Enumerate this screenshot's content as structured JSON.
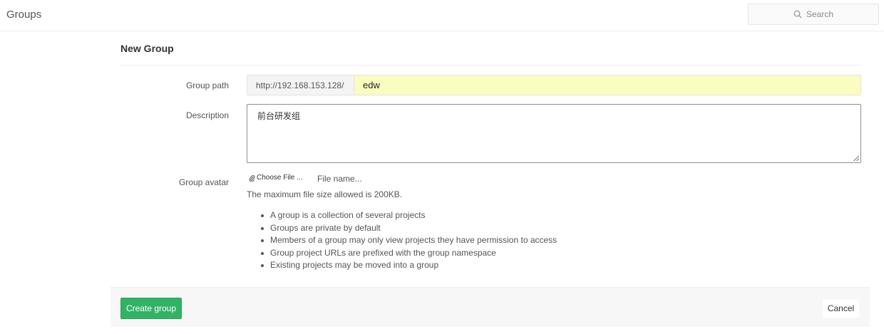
{
  "header": {
    "title": "Groups",
    "search_placeholder": "Search"
  },
  "form": {
    "title": "New Group",
    "group_path": {
      "label": "Group path",
      "prefix": "http://192.168.153.128/",
      "value": "edw"
    },
    "description": {
      "label": "Description",
      "value": "前台研发组"
    },
    "avatar": {
      "label": "Group avatar",
      "choose_file": "Choose File ...",
      "file_name": "File name...",
      "help": "The maximum file size allowed is 200KB."
    },
    "info": [
      "A group is a collection of several projects",
      "Groups are private by default",
      "Members of a group may only view projects they have permission to access",
      "Group project URLs are prefixed with the group namespace",
      "Existing projects may be moved into a group"
    ]
  },
  "actions": {
    "create": "Create group",
    "cancel": "Cancel"
  },
  "colors": {
    "primary": "#32b266",
    "path_input_bg": "#fafcc0"
  }
}
